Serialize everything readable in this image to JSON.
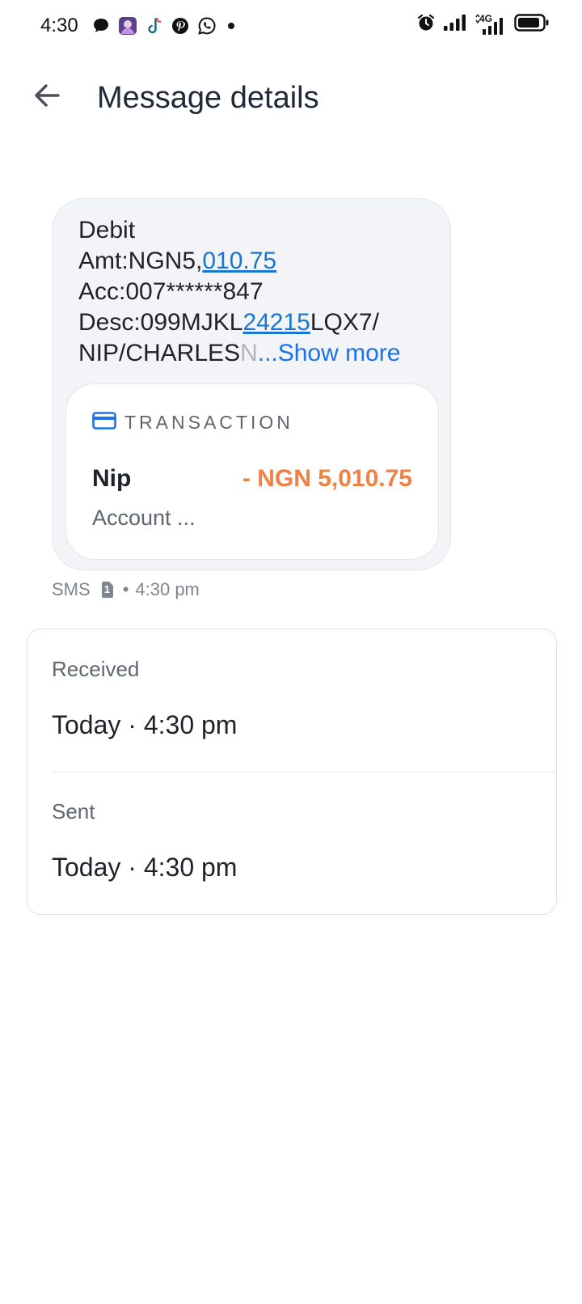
{
  "status_bar": {
    "time": "4:30",
    "network_label": "4G",
    "app_icons": [
      "message-bubble-icon",
      "avatar-app-icon",
      "tiktok-icon",
      "pinterest-icon",
      "whatsapp-icon",
      "more-dot-icon"
    ],
    "right_icons": [
      "alarm-icon",
      "signal-icon",
      "4g-signal-icon",
      "battery-icon"
    ]
  },
  "header": {
    "title": "Message details",
    "back_icon": "back-arrow-icon"
  },
  "message": {
    "line1": "Debit",
    "line2_prefix": "Amt:NGN5,",
    "line2_link": "010.75",
    "line3": "Acc:007******847",
    "line4_prefix": "Desc:099MJKL",
    "line4_link": "24215",
    "line4_suffix": "LQX7/",
    "line5_visible": "NIP/CHARLES",
    "line5_faded": "N",
    "show_more": "...Show more",
    "link_color": "#1976d2"
  },
  "transaction": {
    "label": "TRANSACTION",
    "icon": "credit-card-icon",
    "name": "Nip",
    "amount": "- NGN 5,010.75",
    "subtext": "Account ...",
    "amount_color": "#ee8144"
  },
  "meta": {
    "type": "SMS",
    "sim_icon": "sim-1-icon",
    "sim_number": "1",
    "separator": "•",
    "time": "4:30 pm"
  },
  "details": {
    "received_label": "Received",
    "received_value": "Today · 4:30 pm",
    "sent_label": "Sent",
    "sent_value": "Today · 4:30 pm"
  }
}
